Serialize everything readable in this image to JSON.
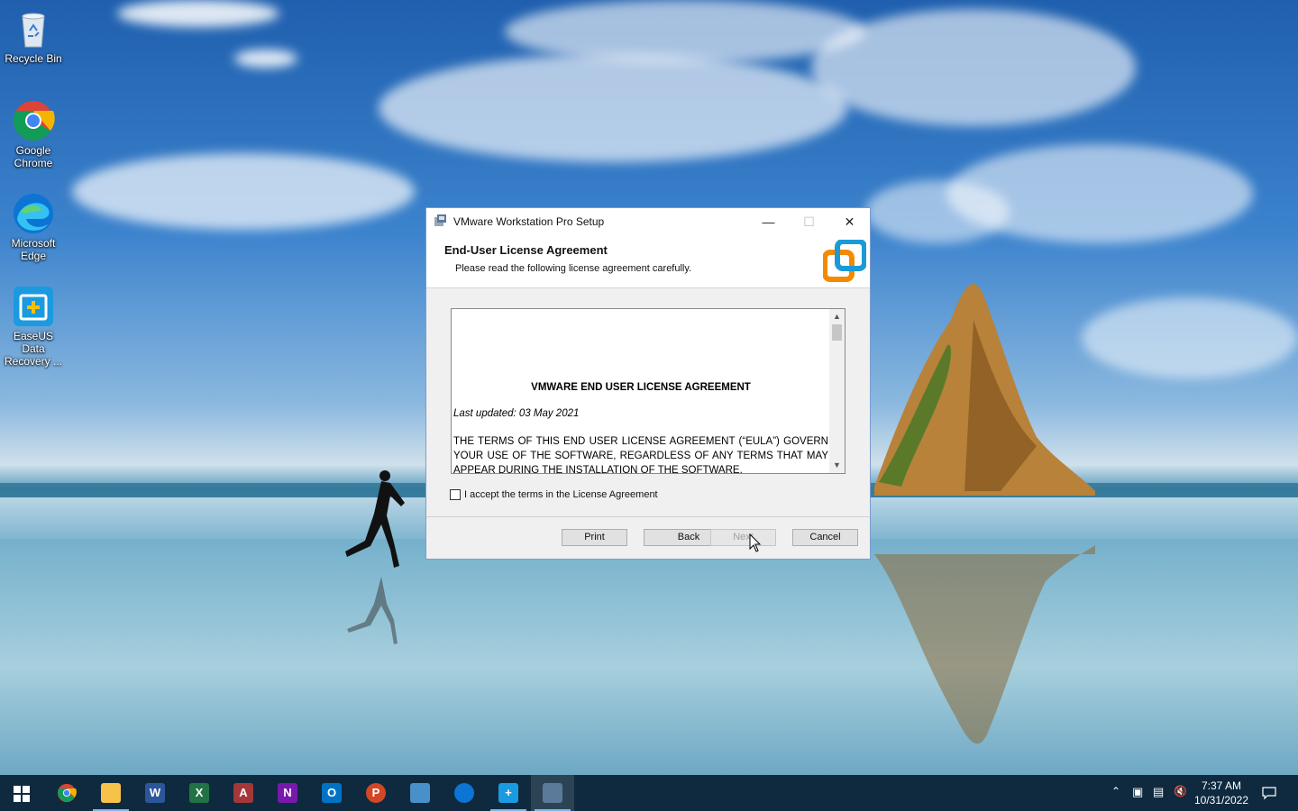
{
  "desktop": {
    "icons": [
      {
        "label": "Recycle Bin",
        "icon": "recycle-bin-icon"
      },
      {
        "label": "Google Chrome",
        "icon": "chrome-icon"
      },
      {
        "label": "Microsoft Edge",
        "icon": "edge-icon"
      },
      {
        "label": "EaseUS Data Recovery ...",
        "icon": "easeus-icon"
      }
    ]
  },
  "dialog": {
    "title": "VMware Workstation Pro Setup",
    "header_title": "End-User License Agreement",
    "header_subtitle": "Please read the following license agreement carefully.",
    "license": {
      "heading": "VMWARE END USER LICENSE AGREEMENT",
      "last_updated": "Last updated: 03 May 2021",
      "body": "THE TERMS OF THIS END USER LICENSE AGREEMENT (“EULA”) GOVERN YOUR USE OF THE SOFTWARE, REGARDLESS OF ANY TERMS THAT MAY APPEAR DURING THE INSTALLATION OF THE SOFTWARE."
    },
    "accept_label": "I accept the terms in the License Agreement",
    "accept_checked": false,
    "buttons": {
      "print": "Print",
      "back": "Back",
      "next": "Next",
      "cancel": "Cancel"
    }
  },
  "taskbar": {
    "apps": [
      "start",
      "chrome",
      "file-explorer",
      "word",
      "excel",
      "access",
      "onenote",
      "outlook",
      "powerpoint",
      "control-panel",
      "edge",
      "easeus",
      "vmware-setup"
    ],
    "clock": {
      "time": "7:37 AM",
      "date": "10/31/2022"
    }
  },
  "colors": {
    "accent": "#0078d7",
    "taskbar": "#0f2a3f",
    "vmware_orange": "#f38b00",
    "vmware_blue": "#1d9ad6"
  }
}
